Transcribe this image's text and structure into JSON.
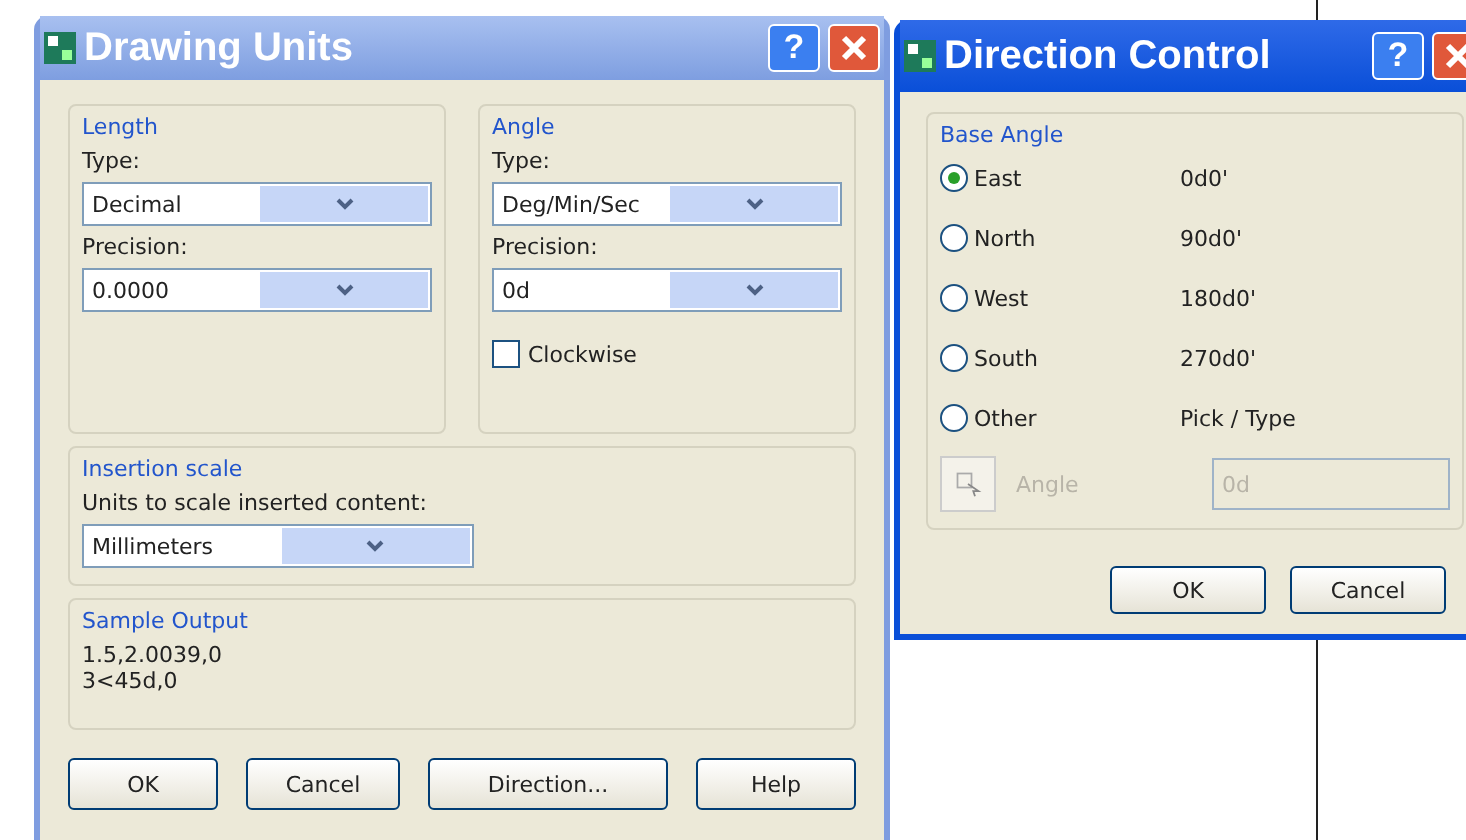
{
  "drawing_units": {
    "title": "Drawing Units",
    "help_glyph": "?",
    "length": {
      "label": "Length",
      "type_label": "Type:",
      "type_value": "Decimal",
      "precision_label": "Precision:",
      "precision_value": "0.0000"
    },
    "angle": {
      "label": "Angle",
      "type_label": "Type:",
      "type_value": "Deg/Min/Sec",
      "precision_label": "Precision:",
      "precision_value": "0d",
      "clockwise": {
        "label": "Clockwise",
        "checked": false
      }
    },
    "insertion_scale": {
      "label": "Insertion scale",
      "units_label": "Units to scale inserted content:",
      "units_value": "Millimeters"
    },
    "sample_output": {
      "label": "Sample Output",
      "lines": [
        "1.5,2.0039,0",
        "3<45d,0"
      ]
    },
    "buttons": [
      "OK",
      "Cancel",
      "Direction...",
      "Help"
    ]
  },
  "direction_control": {
    "title": "Direction Control",
    "help_glyph": "?",
    "base_angle": {
      "label": "Base Angle",
      "options": [
        {
          "label": "East",
          "reading": "0d0'",
          "selected": true
        },
        {
          "label": "North",
          "reading": "90d0'",
          "selected": false
        },
        {
          "label": "West",
          "reading": "180d0'",
          "selected": false
        },
        {
          "label": "South",
          "reading": "270d0'",
          "selected": false
        },
        {
          "label": "Other",
          "reading": "Pick / Type",
          "selected": false
        }
      ]
    },
    "angle_field": {
      "label": "Angle",
      "value": "0d",
      "disabled": true
    },
    "buttons": [
      "OK",
      "Cancel"
    ]
  }
}
